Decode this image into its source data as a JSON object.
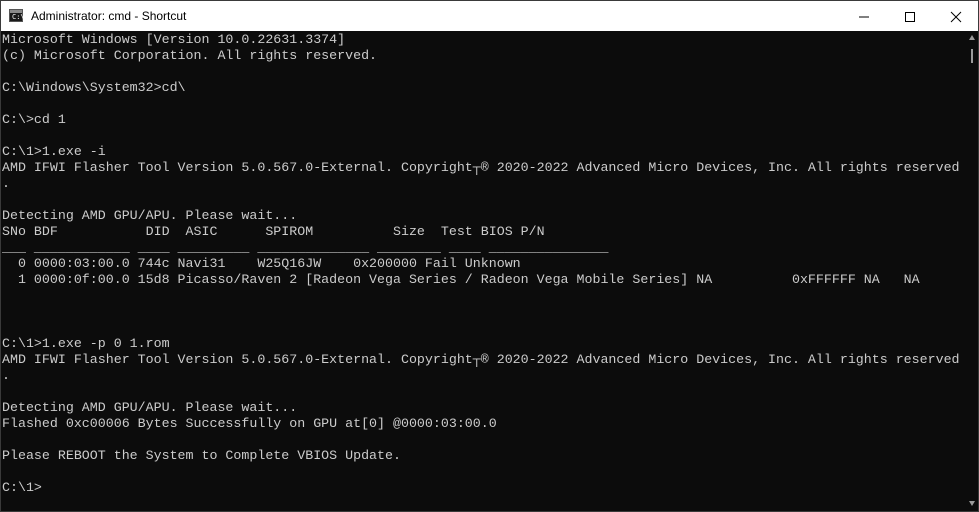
{
  "window": {
    "title": "Administrator: cmd - Shortcut",
    "icon_prompt": "C:\\",
    "controls": {
      "minimize": "minimize-icon",
      "maximize": "maximize-icon",
      "close": "close-icon"
    }
  },
  "console": {
    "lines": [
      "Microsoft Windows [Version 10.0.22631.3374]",
      "(c) Microsoft Corporation. All rights reserved.",
      "",
      "C:\\Windows\\System32>cd\\",
      "",
      "C:\\>cd 1",
      "",
      "C:\\1>1.exe -i",
      "AMD IFWI Flasher Tool Version 5.0.567.0-External. Copyright┬® 2020-2022 Advanced Micro Devices, Inc. All rights reserved",
      ".",
      "",
      "Detecting AMD GPU/APU. Please wait...",
      "SNo BDF           DID  ASIC      SPIROM          Size  Test BIOS P/N",
      "___ ____________ ____ _________ ______________ ________ ____ _______________",
      "  0 0000:03:00.0 744c Navi31    W25Q16JW    0x200000 Fail Unknown",
      "  1 0000:0f:00.0 15d8 Picasso/Raven 2 [Radeon Vega Series / Radeon Vega Mobile Series] NA          0xFFFFFF NA   NA",
      "",
      "",
      "",
      "C:\\1>1.exe -p 0 1.rom",
      "AMD IFWI Flasher Tool Version 5.0.567.0-External. Copyright┬® 2020-2022 Advanced Micro Devices, Inc. All rights reserved",
      ".",
      "",
      "Detecting AMD GPU/APU. Please wait...",
      "Flashed 0xc00006 Bytes Successfully on GPU at[0] @0000:03:00.0",
      "",
      "Please REBOOT the System to Complete VBIOS Update.",
      "",
      "C:\\1>"
    ]
  },
  "colors": {
    "console_bg": "#0c0c0c",
    "console_fg": "#cccccc",
    "titlebar_bg": "#ffffff"
  }
}
